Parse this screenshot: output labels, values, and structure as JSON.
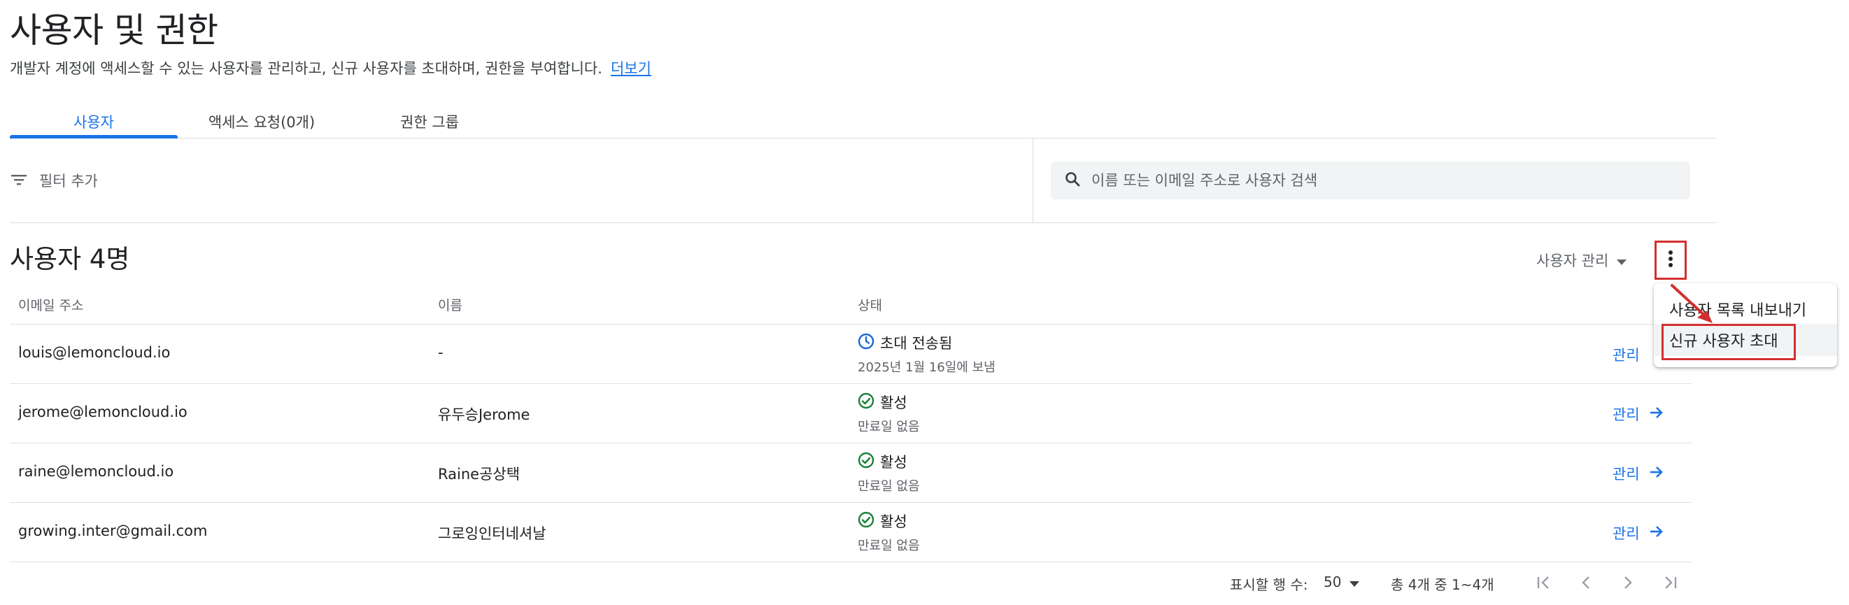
{
  "header": {
    "title": "사용자 및 권한",
    "description": "개발자 계정에 액세스할 수 있는 사용자를 관리하고, 신규 사용자를 초대하며, 권한을 부여합니다.",
    "more_link": "더보기"
  },
  "tabs": [
    {
      "label": "사용자",
      "active": true
    },
    {
      "label": "액세스 요청(0개)",
      "active": false
    },
    {
      "label": "권한 그룹",
      "active": false
    }
  ],
  "filter": {
    "add_filter_label": "필터 추가",
    "search_placeholder": "이름 또는 이메일 주소로 사용자 검색"
  },
  "users_section": {
    "title": "사용자 4명",
    "manage_users_label": "사용자 관리",
    "columns": {
      "email": "이메일 주소",
      "name": "이름",
      "status": "상태"
    },
    "rows": [
      {
        "email": "louis@lemoncloud.io",
        "name": "-",
        "status": "초대 전송됨",
        "status_detail": "2025년 1월 16일에 보냄",
        "status_icon": "clock-icon",
        "action": "관리"
      },
      {
        "email": "jerome@lemoncloud.io",
        "name": "유두승Jerome",
        "status": "활성",
        "status_detail": "만료일 없음",
        "status_icon": "check-circle-icon",
        "action": "관리"
      },
      {
        "email": "raine@lemoncloud.io",
        "name": "Raine공상택",
        "status": "활성",
        "status_detail": "만료일 없음",
        "status_icon": "check-circle-icon",
        "action": "관리"
      },
      {
        "email": "growing.inter@gmail.com",
        "name": "그로잉인터네셔날",
        "status": "활성",
        "status_detail": "만료일 없음",
        "status_icon": "check-circle-icon",
        "action": "관리"
      }
    ]
  },
  "overflow_menu": {
    "items": [
      "사용자 목록 내보내기",
      "신규 사용자 초대"
    ]
  },
  "pagination": {
    "rows_per_page_label": "표시할 행 수:",
    "rows_per_page_value": "50",
    "range_text": "총 4개 중 1~4개"
  },
  "colors": {
    "accent": "#1a73e8",
    "highlight_annotation": "#d32f2f",
    "status_active": "#188038",
    "status_pending": "#1967d2"
  }
}
